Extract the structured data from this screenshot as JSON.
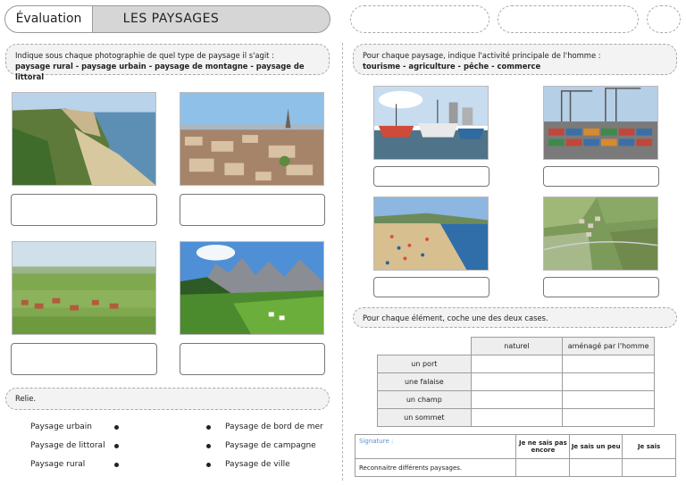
{
  "header": {
    "tab_label": "Évaluation",
    "title": "LES PAYSAGES"
  },
  "section1": {
    "instruction": "Indique sous chaque photographie de quel type de paysage il s'agit :",
    "choices": "paysage rural - paysage urbain - paysage de montagne - paysage de littoral",
    "photos": [
      {
        "icon": "cliff-coast-photo"
      },
      {
        "icon": "city-aerial-photo"
      },
      {
        "icon": "countryside-village-photo"
      },
      {
        "icon": "mountain-alpine-photo"
      }
    ]
  },
  "section2": {
    "instruction": "Pour chaque paysage, indique l'activité principale de l'homme :",
    "choices": "tourisme - agriculture - pêche - commerce",
    "photos": [
      {
        "icon": "fishing-port-photo"
      },
      {
        "icon": "container-port-photo"
      },
      {
        "icon": "beach-photo"
      },
      {
        "icon": "farmland-aerial-photo"
      }
    ]
  },
  "relie": {
    "label": "Relie.",
    "left": [
      "Paysage urbain",
      "Paysage de littoral",
      "Paysage rural"
    ],
    "right": [
      "Paysage de bord de mer",
      "Paysage de campagne",
      "Paysage de ville"
    ]
  },
  "coche": {
    "instruction": "Pour chaque élément, coche une des deux cases.",
    "columns": [
      "naturel",
      "aménagé par l'homme"
    ],
    "rows": [
      "un port",
      "une falaise",
      "un champ",
      "un sommet"
    ]
  },
  "evaluation": {
    "signature": "Signature :",
    "levels": [
      "Je ne sais pas encore",
      "Je sais un peu",
      "Je sais"
    ],
    "skill": "Reconnaitre différents paysages."
  }
}
